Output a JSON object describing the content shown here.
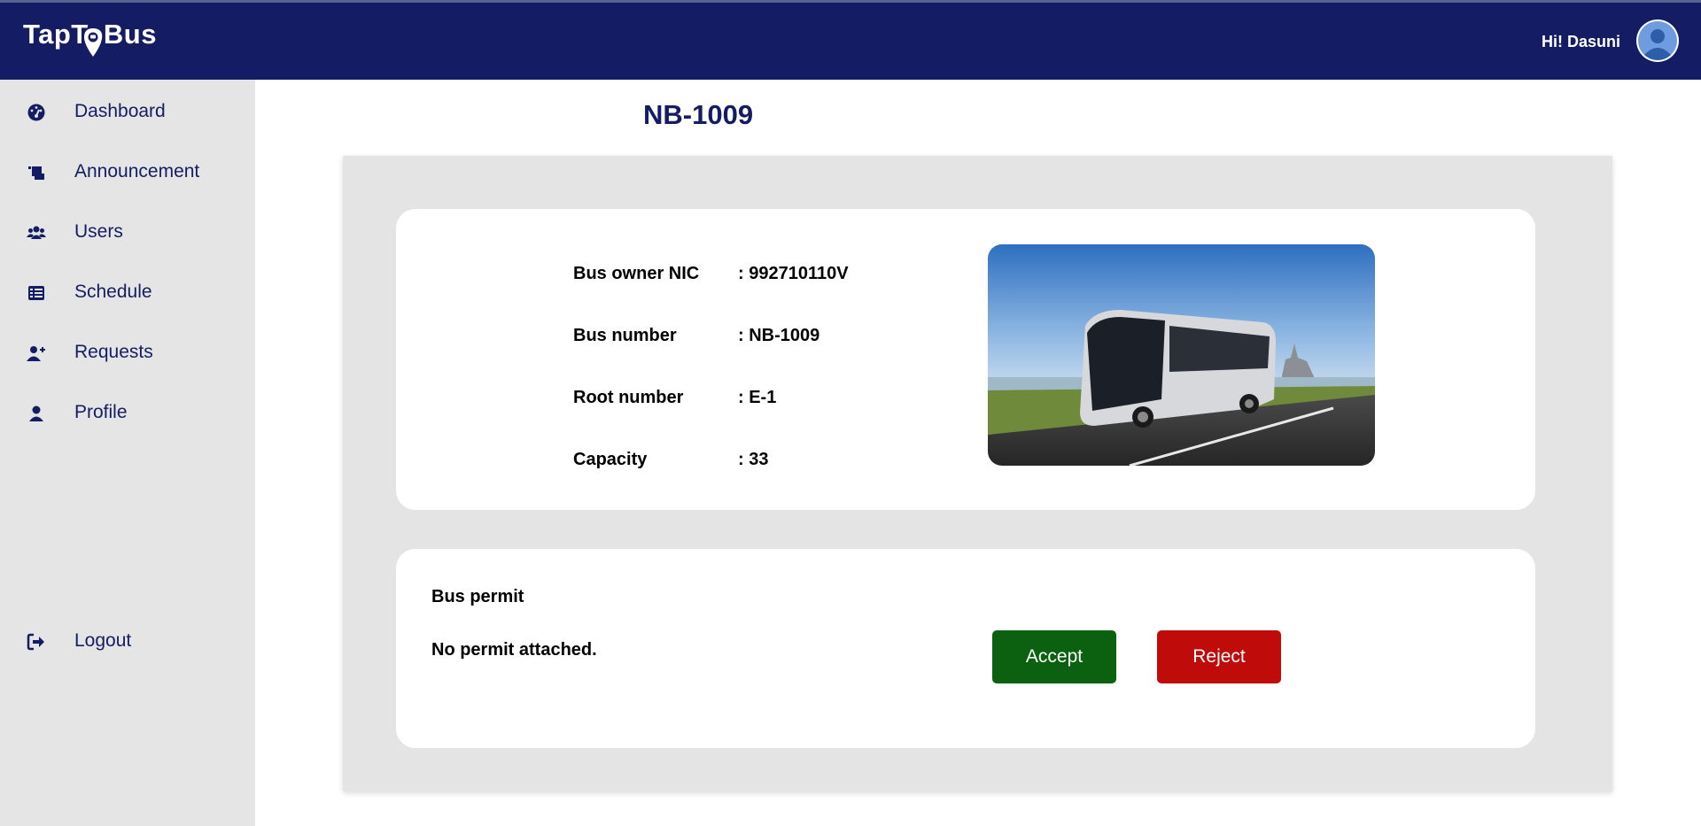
{
  "header": {
    "logo_text": "TapToBus",
    "greeting": "Hi! Dasuni",
    "bar_color": "#141d63"
  },
  "sidebar": {
    "items": [
      {
        "label": "Dashboard",
        "icon": "dashboard-icon"
      },
      {
        "label": "Announcement",
        "icon": "announcement-icon"
      },
      {
        "label": "Users",
        "icon": "users-icon"
      },
      {
        "label": "Schedule",
        "icon": "schedule-icon"
      },
      {
        "label": "Requests",
        "icon": "add-user-icon"
      },
      {
        "label": "Profile",
        "icon": "profile-icon"
      }
    ],
    "logout": {
      "label": "Logout",
      "icon": "logout-icon"
    }
  },
  "page": {
    "title": "NB-1009"
  },
  "details": {
    "owner_nic": {
      "label": "Bus owner NIC",
      "value": ": 992710110V"
    },
    "bus_number": {
      "label": "Bus number",
      "value": ": NB-1009"
    },
    "root_number": {
      "label": "Root number",
      "value": ": E-1"
    },
    "capacity": {
      "label": "Capacity",
      "value": ": 33"
    }
  },
  "permit": {
    "title": "Bus permit",
    "note": "No permit attached."
  },
  "actions": {
    "accept_label": "Accept",
    "reject_label": "Reject",
    "accept_color": "#0b6110",
    "reject_color": "#c00b0b"
  }
}
